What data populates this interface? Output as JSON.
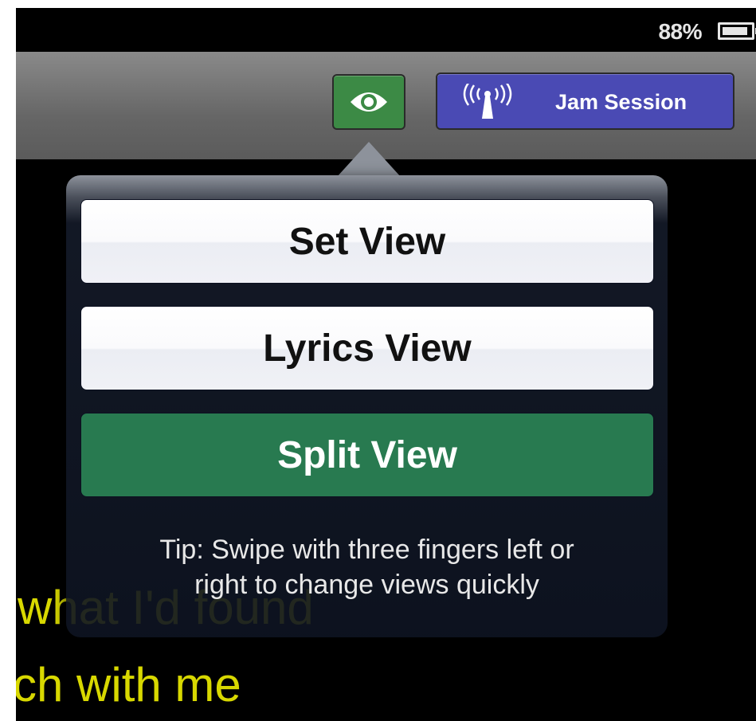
{
  "status_bar": {
    "battery_percent": "88%",
    "battery_icon": "battery-icon"
  },
  "toolbar": {
    "view_button_icon": "eye-icon",
    "view_button_color": "#3c8a45",
    "jam_session": {
      "label": "Jam Session",
      "icon": "broadcast-antenna-icon",
      "color": "#4a4ab4"
    }
  },
  "background_lyrics": [
    "what I'd found",
    "ch with me"
  ],
  "popover": {
    "options": [
      {
        "label": "Set View",
        "selected": false
      },
      {
        "label": "Lyrics View",
        "selected": false
      },
      {
        "label": "Split View",
        "selected": true
      }
    ],
    "tip_line_1": "Tip: Swipe with three fingers left or",
    "tip_line_2": "right to change views quickly",
    "selected_color": "#287a50"
  },
  "lyric_color": "#d8d800"
}
